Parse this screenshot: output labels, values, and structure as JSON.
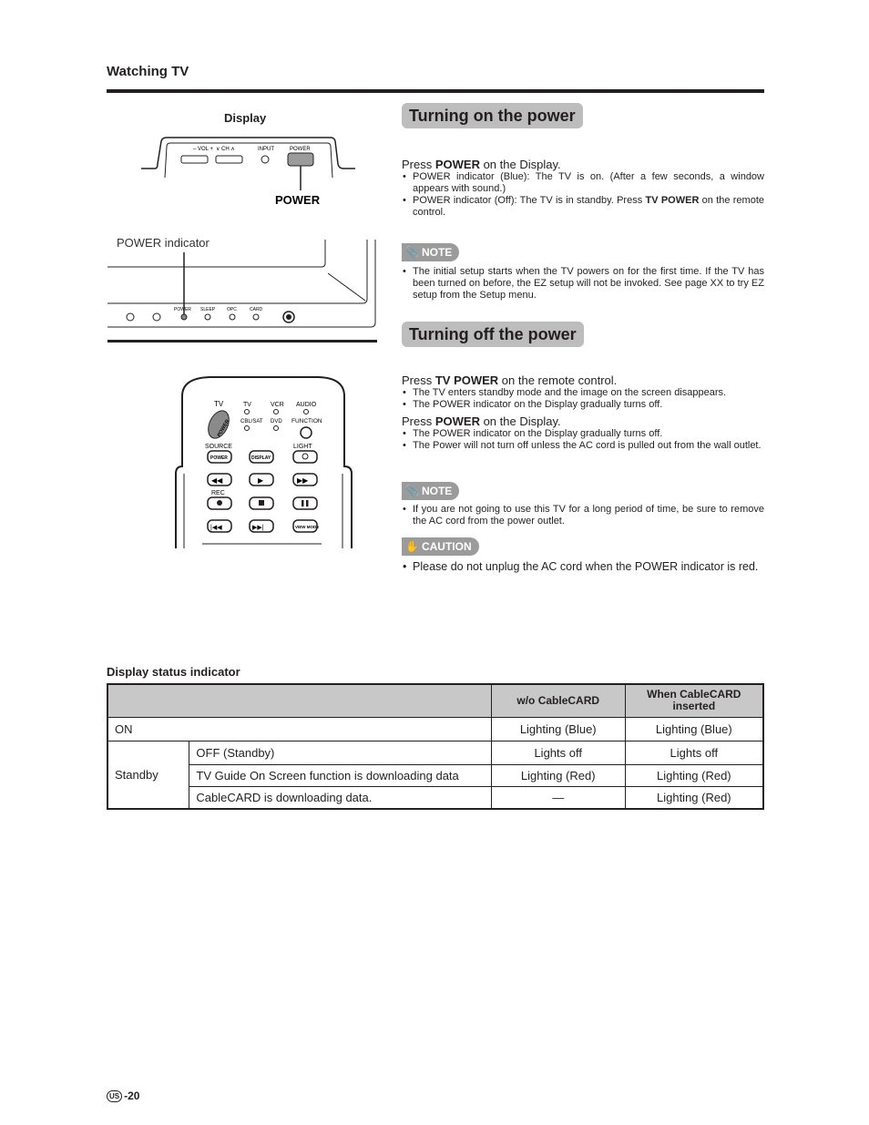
{
  "header": {
    "section": "Watching TV"
  },
  "diagram_display": {
    "label": "Display",
    "buttons": [
      "– VOL +",
      "∨ CH ∧",
      "INPUT",
      "POWER"
    ],
    "power_callout": "POWER",
    "indicator_callout": "POWER indicator",
    "indicators": [
      "POWER",
      "SLEEP",
      "OPC",
      "CARD"
    ]
  },
  "diagram_remote": {
    "labels": [
      "TV",
      "TV",
      "VCR",
      "AUDIO",
      "CBL/SAT",
      "DVD",
      "FUNCTION",
      "SOURCE",
      "LIGHT",
      "REC"
    ],
    "buttons": [
      "POWER",
      "POWER",
      "DISPLAY",
      "VIEW MODE"
    ]
  },
  "turning_on": {
    "title": "Turning on the power",
    "press": {
      "pre": "Press ",
      "bold": "POWER",
      "post": " on the Display."
    },
    "bullets": [
      {
        "pre": "POWER indicator (Blue): The TV is on. (After a few seconds, a window appears with sound.)",
        "bold": "",
        "post": ""
      },
      {
        "pre": "POWER indicator (Off): The TV is in standby. Press ",
        "bold": "TV POWER",
        "post": " on the remote control."
      }
    ],
    "note_label": "NOTE",
    "note": [
      "The initial setup starts when the TV powers on for the first time. If the TV has been turned on before, the EZ setup will not be invoked. See page XX to try EZ setup from the Setup menu."
    ]
  },
  "turning_off": {
    "title": "Turning off the power",
    "press1": {
      "pre": "Press ",
      "bold": "TV POWER",
      "post": " on the remote control."
    },
    "bullets1": [
      "The TV enters standby mode and the image on the screen disappears.",
      "The POWER indicator on the Display gradually turns off."
    ],
    "press2": {
      "pre": "Press ",
      "bold": "POWER",
      "post": " on the Display."
    },
    "bullets2": [
      "The POWER indicator on the Display gradually turns off.",
      "The Power will not turn off unless the AC cord is pulled out from the wall outlet."
    ],
    "note_label": "NOTE",
    "note": [
      "If you are not going to use this TV for a long period of time, be sure to remove the AC cord from the power outlet."
    ],
    "caution_label": "CAUTION",
    "caution": [
      "Please do not unplug the AC cord when the POWER indicator is red."
    ]
  },
  "status_table": {
    "title": "Display status indicator",
    "headers": [
      "",
      "w/o CableCARD",
      "When CableCARD inserted"
    ],
    "on_row": {
      "label": "ON",
      "wo": "Lighting (Blue)",
      "with": "Lighting (Blue)"
    },
    "standby_label": "Standby",
    "standby_rows": [
      {
        "label": "OFF (Standby)",
        "wo": "Lights off",
        "with": "Lights off"
      },
      {
        "label": "TV Guide On Screen function is downloading data",
        "wo": "Lighting (Red)",
        "with": "Lighting (Red)"
      },
      {
        "label": "CableCARD is downloading data.",
        "wo": "—",
        "with": "Lighting (Red)"
      }
    ]
  },
  "footer": {
    "region": "US",
    "page": "-20"
  }
}
